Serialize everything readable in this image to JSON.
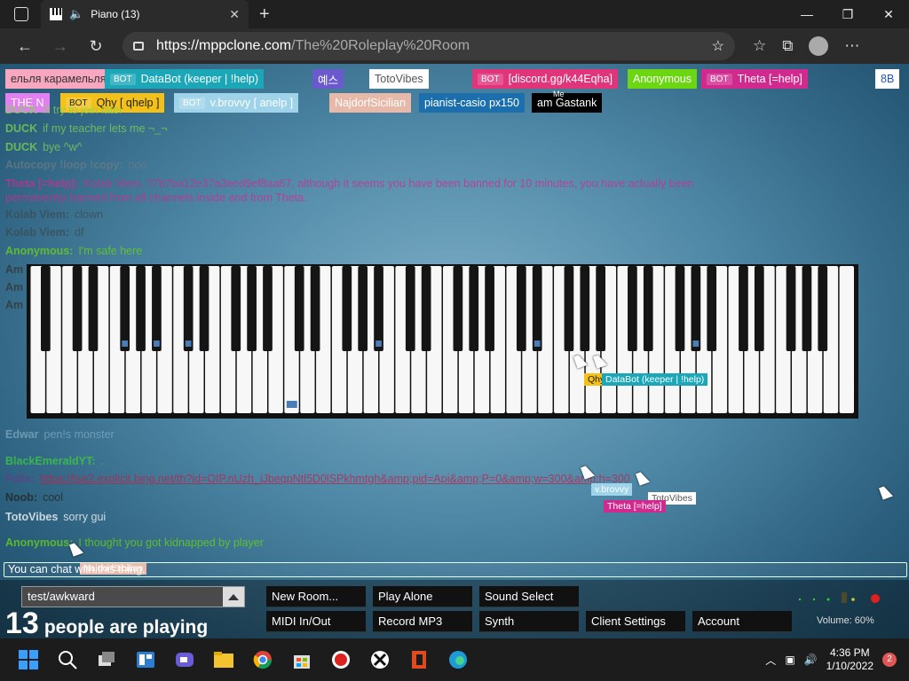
{
  "browser": {
    "tab_title": "Piano (13)",
    "url_host": "https://mppclone.com",
    "url_path": "/The%20Roleplay%20Room"
  },
  "chips_row1": [
    {
      "text": "ельля карамельля",
      "bg": "#f7a8c0",
      "color": "#333"
    },
    {
      "text": "DataBot (keeper | !help)",
      "bot": true,
      "bg": "#1ba7b8"
    },
    {
      "text": "예스",
      "bg": "#6a5acd"
    },
    {
      "text": "TotoVibes",
      "bg": "#ffffff",
      "color": "#555"
    },
    {
      "text": "[discord.gg/k44Eqha]",
      "bot": true,
      "bg": "#e0357a"
    },
    {
      "text": "Anonymous",
      "bg": "#6cd612"
    },
    {
      "text": "Theta [=help]",
      "bot": true,
      "bg": "#d12a8f"
    },
    {
      "text": "8B",
      "bg": "#ffffff",
      "color": "#2255bb"
    }
  ],
  "chips_row2": [
    {
      "text": "THE N",
      "bg": "#e27ff1"
    },
    {
      "text": "Qhy [ qhelp ]",
      "bot": true,
      "bg": "#f3c118",
      "color": "#222"
    },
    {
      "text": "v.brovvy [ anelp ]",
      "bot": true,
      "bg": "#9fd3ea"
    },
    {
      "text": "NajdorfSicilian",
      "bg": "#e8b8a8"
    },
    {
      "text": "pianist-casio px150",
      "bg": "#1b6fad"
    },
    {
      "text": "am Gastank",
      "bg": "#000000",
      "tag": "Me"
    }
  ],
  "chat": [
    {
      "name": "DUCK",
      "msg": "ill try to join later",
      "color": "#7fd650"
    },
    {
      "name": "DUCK",
      "msg": "if my teacher lets me ¬_¬",
      "color": "#7fd650"
    },
    {
      "name": "DUCK",
      "msg": "bye ^w^",
      "color": "#7fd650"
    },
    {
      "name": "Autocopy !loop !copy:",
      "msg": "noo",
      "color": "#6b7b85"
    },
    {
      "name": "Theta [=help]:",
      "msg": "Kolab Viem, 77b7ba12e37a3eed9ef8aa67, although it seems you have been banned for 10 minutes, you have actually been",
      "color": "#d12a8f"
    },
    {
      "name": "",
      "msg": "permanently banned from all channels inside and from Theta.",
      "color": "#d12a8f"
    },
    {
      "name": "Kolab Viem:",
      "msg": "clown",
      "color": "#3b4a55"
    },
    {
      "name": "Kolab Viem:",
      "msg": "df",
      "color": "#3b4a55"
    },
    {
      "name": "Anonymous:",
      "msg": "I'm safe here",
      "color": "#6cd612"
    },
    {
      "name": "Felix:",
      "msg": "https://tse2.explicit.bing.net/th?id=OIP.nUzh_iJbeqpNtl5D0lSPkhmtgh&amp;pid=Api&amp;P=0&amp;w=300&amp;h=300",
      "color": "#6a3b8b"
    },
    {
      "name": "Noob:",
      "msg": "cool",
      "color": "#222222"
    },
    {
      "name": "TotoVibes",
      "msg": "sorry gui",
      "color": "#ffffff"
    },
    {
      "name": "Anonymous:",
      "msg": "I thought you got kidnapped by player",
      "color": "#6cd612"
    },
    {
      "name": "BlackEmeraldYT:",
      "msg": ".",
      "color": "#3bcf3b"
    },
    {
      "name": "Edwar",
      "msg": "pen!s monster",
      "color": "#7fa9c3"
    }
  ],
  "side_names": [
    "Am",
    "Am",
    "Am"
  ],
  "chat_input_placeholder": "You can chat with this thing.",
  "cursor_labels": [
    {
      "text": "Qhy",
      "bg": "#f3c118",
      "color": "#222"
    },
    {
      "text": "DataBot (keeper | !help)",
      "bg": "#1ba7b8",
      "color": "#fff"
    },
    {
      "text": "v.brovvy",
      "bg": "#9fd3ea",
      "color": "#fff"
    },
    {
      "text": "TotoVibes",
      "bg": "#ffffff",
      "color": "#555"
    },
    {
      "text": "Theta [=help]",
      "bg": "#d12a8f",
      "color": "#fff"
    },
    {
      "text": "NajdorfSicilian",
      "bg": "#e8b8a8",
      "color": "#fff"
    }
  ],
  "bottom": {
    "room_name": "test/awkward",
    "count": "13",
    "count_text": "people are playing",
    "buttons": [
      "New Room...",
      "Play Alone",
      "Sound Select",
      "MIDI In/Out",
      "Record MP3",
      "Synth",
      "Client Settings",
      "Account"
    ],
    "volume": "Volume: 60%"
  },
  "taskbar": {
    "time": "4:36 PM",
    "date": "1/10/2022",
    "notifications": "2"
  },
  "piano": {
    "white_keys": 52,
    "pressed_white": [
      16
    ],
    "pressed_black": [
      3,
      5,
      6,
      15,
      22,
      29
    ]
  },
  "colors": {
    "pressed": "#4a7db5"
  }
}
